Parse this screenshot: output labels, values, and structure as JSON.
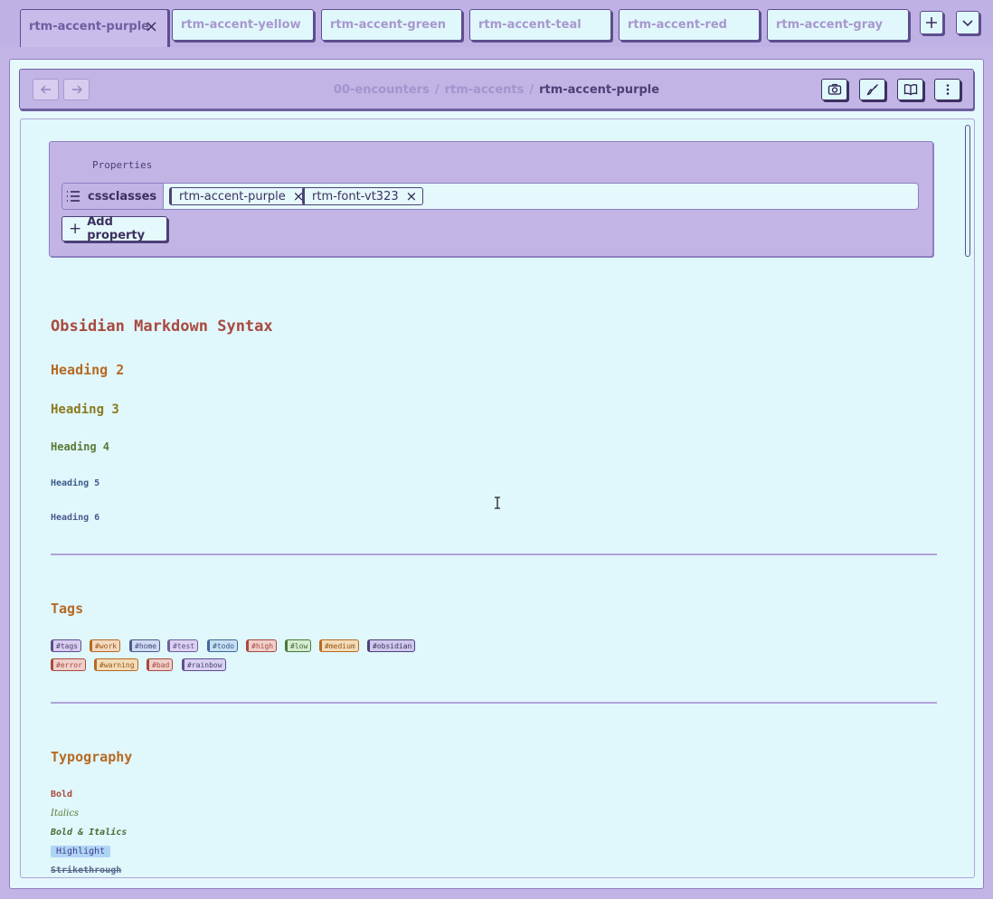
{
  "tabs": [
    {
      "label": "rtm-accent-purple",
      "active": true
    },
    {
      "label": "rtm-accent-yellow"
    },
    {
      "label": "rtm-accent-green"
    },
    {
      "label": "rtm-accent-teal"
    },
    {
      "label": "rtm-accent-red"
    },
    {
      "label": "rtm-accent-gray"
    }
  ],
  "tab_close_glyph": "×",
  "breadcrumb": {
    "parts": [
      "00-encounters",
      "rtm-accents"
    ],
    "current": "rtm-accent-purple",
    "separator": "/"
  },
  "properties": {
    "title": "Properties",
    "key": "cssclasses",
    "values": [
      "rtm-accent-purple",
      "rtm-font-vt323"
    ],
    "remove_glyph": "×",
    "add_label": "Add property",
    "add_glyph": "+"
  },
  "document": {
    "h1": "Obsidian Markdown Syntax",
    "h2": "Heading 2",
    "h3": "Heading 3",
    "h4": "Heading 4",
    "h5": "Heading 5",
    "h6": "Heading 6",
    "tags_heading": "Tags",
    "tags": [
      "#tags",
      "#work",
      "#home",
      "#test",
      "#todo",
      "#high",
      "#low",
      "#medium",
      "#obsidian",
      "#error",
      "#warning",
      "#bad",
      "#rainbow"
    ],
    "typography_heading": "Typography",
    "bold": "Bold",
    "italics": "Italics",
    "bold_italics": "Bold & Italics",
    "highlight": "Highlight",
    "strikethrough": "Strikethrough"
  },
  "colors": {
    "accent": "#c3b4e6",
    "background": "#e0f7fc",
    "border": "#5d4e8f",
    "h1": "#a84a3e",
    "h2": "#b76a22"
  }
}
